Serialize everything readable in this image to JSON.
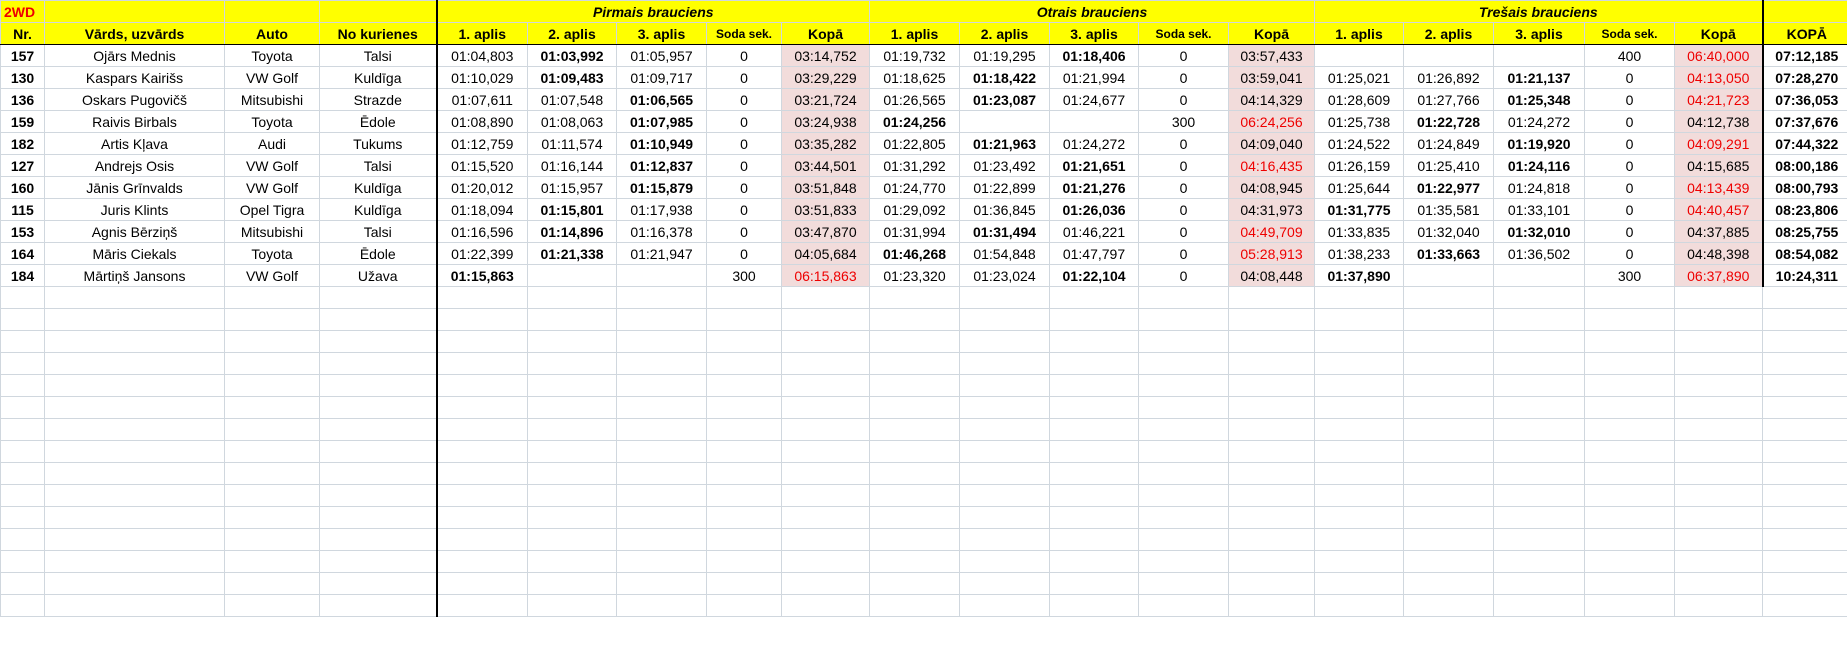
{
  "sheet": {
    "category": "2WD",
    "groups": [
      "Pirmais brauciens",
      "Otrais brauciens",
      "Trešais brauciens"
    ],
    "headers": [
      "Nr.",
      "Vārds, uzvārds",
      "Auto",
      "No kurienes",
      "1. aplis",
      "2. aplis",
      "3. aplis",
      "Soda sek.",
      "Kopā",
      "1. aplis",
      "2. aplis",
      "3. aplis",
      "Soda sek.",
      "Kopā",
      "1. aplis",
      "2. aplis",
      "3. aplis",
      "Soda sek.",
      "Kopā",
      "KOPĀ"
    ],
    "rows": [
      [
        "157",
        "Ojārs Mednis",
        "Toyota",
        "Talsi",
        "01:04,803",
        "01:03,992",
        "01:05,957",
        "0",
        "03:14,752",
        "01:19,732",
        "01:19,295",
        "01:18,406",
        "0",
        "03:57,433",
        "",
        "",
        "",
        "400",
        "06:40,000",
        "07:12,185"
      ],
      [
        "130",
        "Kaspars Kairišs",
        "VW Golf",
        "Kuldīga",
        "01:10,029",
        "01:09,483",
        "01:09,717",
        "0",
        "03:29,229",
        "01:18,625",
        "01:18,422",
        "01:21,994",
        "0",
        "03:59,041",
        "01:25,021",
        "01:26,892",
        "01:21,137",
        "0",
        "04:13,050",
        "07:28,270"
      ],
      [
        "136",
        "Oskars Pugovičš",
        "Mitsubishi",
        "Strazde",
        "01:07,611",
        "01:07,548",
        "01:06,565",
        "0",
        "03:21,724",
        "01:26,565",
        "01:23,087",
        "01:24,677",
        "0",
        "04:14,329",
        "01:28,609",
        "01:27,766",
        "01:25,348",
        "0",
        "04:21,723",
        "07:36,053"
      ],
      [
        "159",
        "Raivis Birbals",
        "Toyota",
        "Ēdole",
        "01:08,890",
        "01:08,063",
        "01:07,985",
        "0",
        "03:24,938",
        "01:24,256",
        "",
        "",
        "300",
        "06:24,256",
        "01:25,738",
        "01:22,728",
        "01:24,272",
        "0",
        "04:12,738",
        "07:37,676"
      ],
      [
        "182",
        "Artis Kļava",
        "Audi",
        "Tukums",
        "01:12,759",
        "01:11,574",
        "01:10,949",
        "0",
        "03:35,282",
        "01:22,805",
        "01:21,963",
        "01:24,272",
        "0",
        "04:09,040",
        "01:24,522",
        "01:24,849",
        "01:19,920",
        "0",
        "04:09,291",
        "07:44,322"
      ],
      [
        "127",
        "Andrejs Osis",
        "VW Golf",
        "Talsi",
        "01:15,520",
        "01:16,144",
        "01:12,837",
        "0",
        "03:44,501",
        "01:31,292",
        "01:23,492",
        "01:21,651",
        "0",
        "04:16,435",
        "01:26,159",
        "01:25,410",
        "01:24,116",
        "0",
        "04:15,685",
        "08:00,186"
      ],
      [
        "160",
        "Jānis Grīnvalds",
        "VW Golf",
        "Kuldīga",
        "01:20,012",
        "01:15,957",
        "01:15,879",
        "0",
        "03:51,848",
        "01:24,770",
        "01:22,899",
        "01:21,276",
        "0",
        "04:08,945",
        "01:25,644",
        "01:22,977",
        "01:24,818",
        "0",
        "04:13,439",
        "08:00,793"
      ],
      [
        "115",
        "Juris Klints",
        "Opel Tigra",
        "Kuldīga",
        "01:18,094",
        "01:15,801",
        "01:17,938",
        "0",
        "03:51,833",
        "01:29,092",
        "01:36,845",
        "01:26,036",
        "0",
        "04:31,973",
        "01:31,775",
        "01:35,581",
        "01:33,101",
        "0",
        "04:40,457",
        "08:23,806"
      ],
      [
        "153",
        "Agnis Bērziņš",
        "Mitsubishi",
        "Talsi",
        "01:16,596",
        "01:14,896",
        "01:16,378",
        "0",
        "03:47,870",
        "01:31,994",
        "01:31,494",
        "01:46,221",
        "0",
        "04:49,709",
        "01:33,835",
        "01:32,040",
        "01:32,010",
        "0",
        "04:37,885",
        "08:25,755"
      ],
      [
        "164",
        "Māris Ciekals",
        "Toyota",
        "Ēdole",
        "01:22,399",
        "01:21,338",
        "01:21,947",
        "0",
        "04:05,684",
        "01:46,268",
        "01:54,848",
        "01:47,797",
        "0",
        "05:28,913",
        "01:38,233",
        "01:33,663",
        "01:36,502",
        "0",
        "04:48,398",
        "08:54,082"
      ],
      [
        "184",
        "Mārtiņš Jansons",
        "VW Golf",
        "Užava",
        "01:15,863",
        "",
        "",
        "300",
        "06:15,863",
        "01:23,320",
        "01:23,024",
        "01:22,104",
        "0",
        "04:08,448",
        "01:37,890",
        "",
        "",
        "300",
        "06:37,890",
        "10:24,311"
      ]
    ],
    "best_cols": [
      [
        5,
        11,
        0
      ],
      [
        5,
        10,
        16
      ],
      [
        6,
        10,
        16
      ],
      [
        6,
        9,
        15
      ],
      [
        6,
        10,
        16
      ],
      [
        6,
        11,
        16
      ],
      [
        6,
        11,
        15
      ],
      [
        5,
        11,
        14
      ],
      [
        5,
        10,
        16
      ],
      [
        5,
        9,
        15
      ],
      [
        4,
        11,
        14
      ]
    ],
    "red_sums": [
      [
        18
      ],
      [
        18
      ],
      [
        18
      ],
      [
        13
      ],
      [
        18
      ],
      [
        13
      ],
      [
        18
      ],
      [
        18
      ],
      [
        13
      ],
      [
        13
      ],
      [
        8,
        18
      ]
    ],
    "colors": {
      "header_bg": "#ffff00",
      "sum_bg": "#f2dcdb",
      "red_text": "#e00000"
    }
  }
}
